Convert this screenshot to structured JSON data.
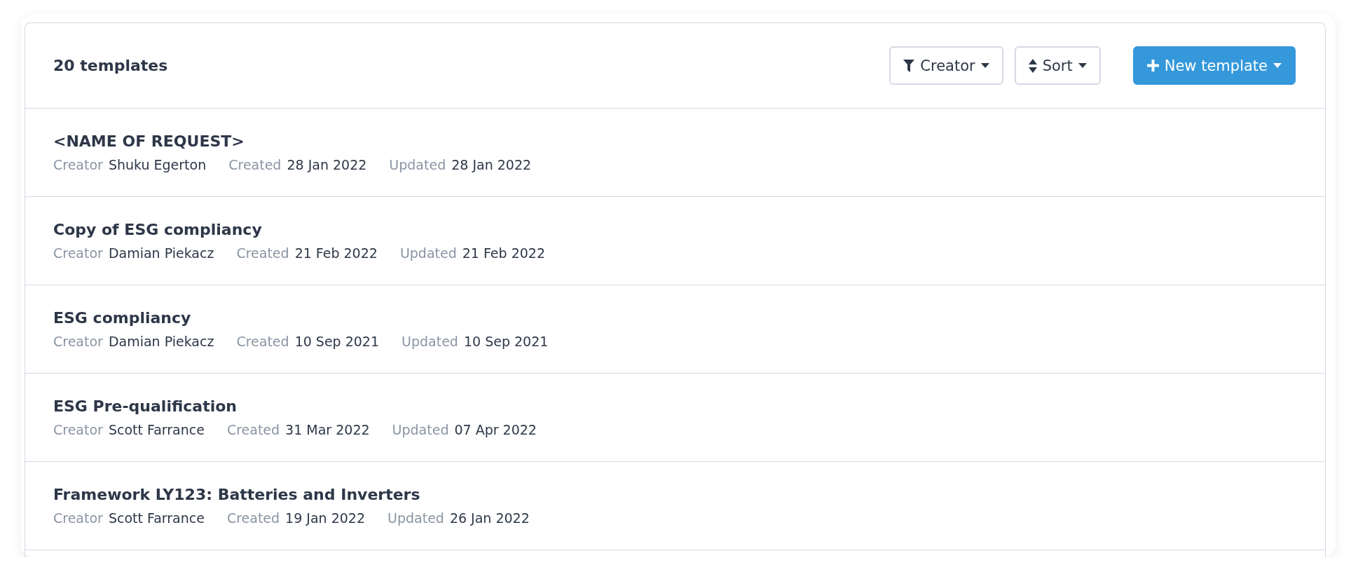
{
  "header": {
    "count": "20 templates",
    "buttons": [
      {
        "kind": "filter",
        "label": "Creator"
      },
      {
        "kind": "sort",
        "label": "Sort"
      },
      {
        "kind": "primary",
        "label": "New template"
      }
    ]
  },
  "templates": [
    {
      "title": "<NAME OF REQUEST>",
      "creator_label": "Creator",
      "creator": "Shuku Egerton",
      "created_label": "Created",
      "created": "28 Jan 2022",
      "updated_label": "Updated",
      "updated": "28 Jan 2022"
    },
    {
      "title": "Copy of ESG compliancy",
      "creator_label": "Creator",
      "creator": "Damian Piekacz",
      "created_label": "Created",
      "created": "21 Feb 2022",
      "updated_label": "Updated",
      "updated": "21 Feb 2022"
    },
    {
      "title": "ESG compliancy",
      "creator_label": "Creator",
      "creator": "Damian Piekacz",
      "created_label": "Created",
      "created": "10 Sep 2021",
      "updated_label": "Updated",
      "updated": "10 Sep 2021"
    },
    {
      "title": "ESG Pre-qualification",
      "creator_label": "Creator",
      "creator": "Scott Farrance",
      "created_label": "Created",
      "created": "31 Mar 2022",
      "updated_label": "Updated",
      "updated": "07 Apr 2022"
    },
    {
      "title": "Framework LY123: Batteries and Inverters",
      "creator_label": "Creator",
      "creator": "Scott Farrance",
      "created_label": "Created",
      "created": "19 Jan 2022",
      "updated_label": "Updated",
      "updated": "26 Jan 2022"
    }
  ]
}
